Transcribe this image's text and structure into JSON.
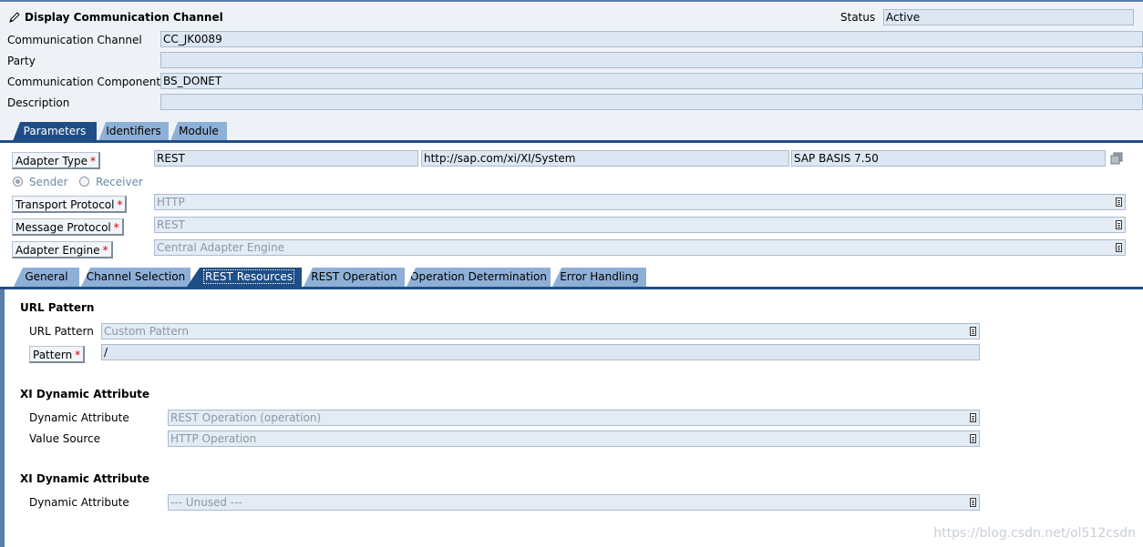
{
  "header": {
    "title": "Display Communication Channel",
    "status_label": "Status",
    "status_value": "Active"
  },
  "fields": {
    "communication_channel": {
      "label": "Communication Channel",
      "value": "CC_JK0089"
    },
    "party": {
      "label": "Party",
      "value": ""
    },
    "communication_component": {
      "label": "Communication Component",
      "value": "BS_DONET"
    },
    "description": {
      "label": "Description",
      "value": ""
    }
  },
  "main_tabs": [
    "Parameters",
    "Identifiers",
    "Module"
  ],
  "adapter": {
    "adapter_type_label": "Adapter Type",
    "adapter_type_value": "REST",
    "namespace_value": "http://sap.com/xi/XI/System",
    "release_value": "SAP BASIS 7.50",
    "sender_label": "Sender",
    "receiver_label": "Receiver",
    "transport_protocol_label": "Transport Protocol",
    "transport_protocol_value": "HTTP",
    "message_protocol_label": "Message Protocol",
    "message_protocol_value": "REST",
    "adapter_engine_label": "Adapter Engine",
    "adapter_engine_value": "Central Adapter Engine",
    "required_marker": "*"
  },
  "sub_tabs": [
    "General",
    "Channel Selection",
    "REST Resources",
    "REST Operation",
    "Operation Determination",
    "Error Handling"
  ],
  "url_pattern_section": {
    "title": "URL Pattern",
    "url_pattern_label": "URL Pattern",
    "url_pattern_value": "Custom Pattern",
    "pattern_label": "Pattern",
    "pattern_value": "/"
  },
  "xi_dynamic_1": {
    "title": "XI Dynamic Attribute",
    "dynamic_attribute_label": "Dynamic Attribute",
    "dynamic_attribute_value": "REST Operation (operation)",
    "value_source_label": "Value Source",
    "value_source_value": "HTTP Operation"
  },
  "xi_dynamic_2": {
    "title": "XI Dynamic Attribute",
    "dynamic_attribute_label": "Dynamic Attribute",
    "dynamic_attribute_value": "--- Unused ---"
  },
  "watermark": "https://blog.csdn.net/ol512csdn"
}
